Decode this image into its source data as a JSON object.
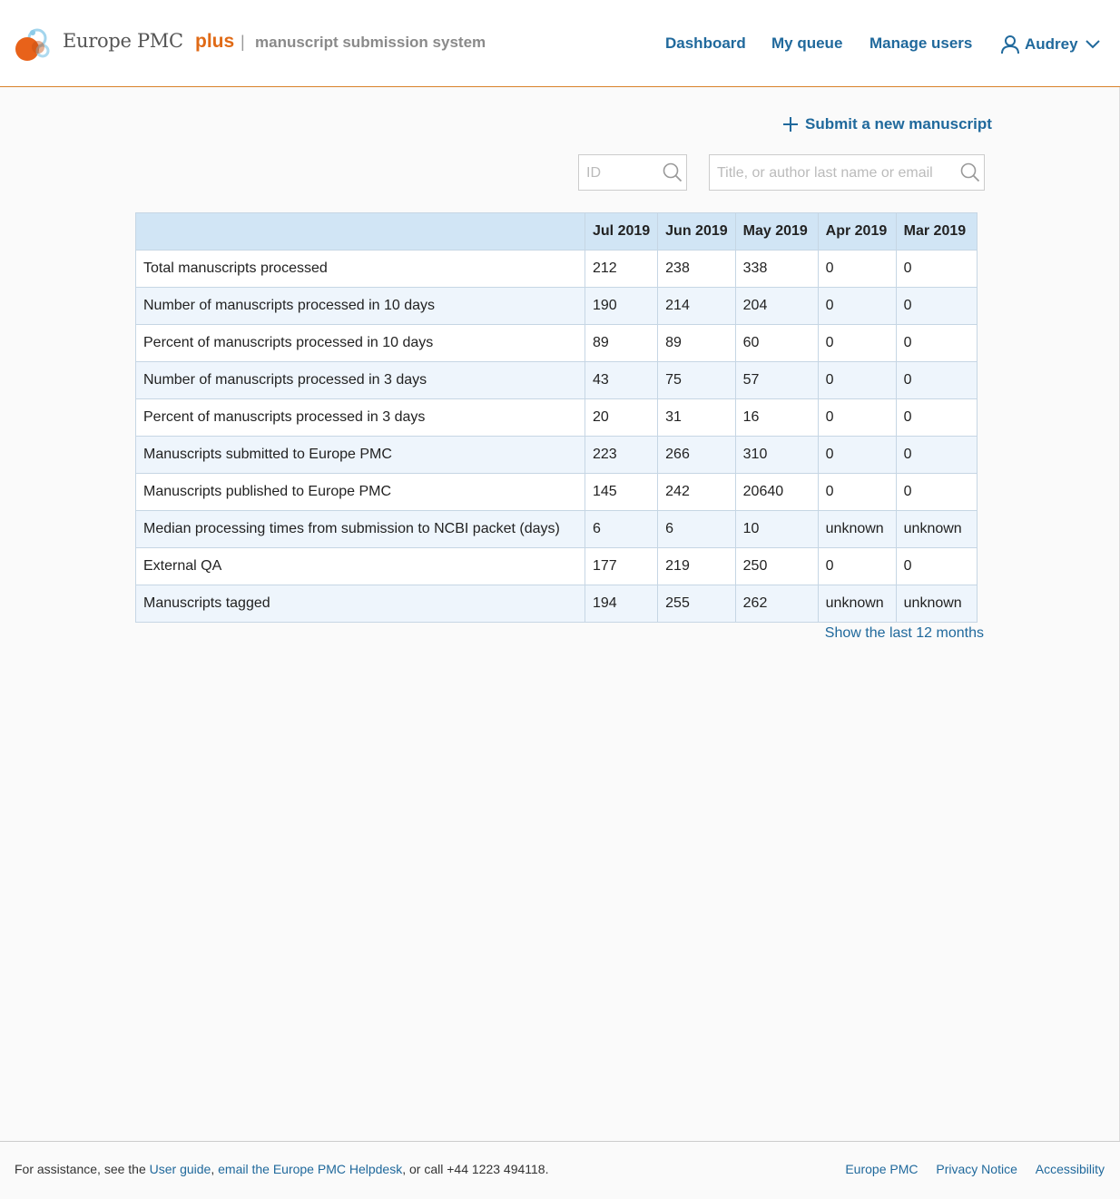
{
  "header": {
    "brand": "Europe PMC",
    "brand_plus": "plus",
    "separator": "|",
    "subtitle": "manuscript submission system",
    "nav": {
      "dashboard": "Dashboard",
      "my_queue": "My queue",
      "manage_users": "Manage users"
    },
    "user": {
      "name": "Audrey",
      "icon": "user-icon",
      "chevron_icon": "chevron-down-icon"
    }
  },
  "actions": {
    "submit_label": "Submit a new manuscript",
    "submit_icon": "plus-icon"
  },
  "search": {
    "id_placeholder": "ID",
    "id_value": "",
    "query_placeholder": "Title, or author last name or email",
    "query_value": "",
    "icon": "search-icon"
  },
  "stats": {
    "columns": [
      "",
      "Jul 2019",
      "Jun 2019",
      "May 2019",
      "Apr 2019",
      "Mar 2019"
    ],
    "rows": [
      [
        "Total manuscripts processed",
        "212",
        "238",
        "338",
        "0",
        "0"
      ],
      [
        "Number of manuscripts processed in 10 days",
        "190",
        "214",
        "204",
        "0",
        "0"
      ],
      [
        "Percent of manuscripts processed in 10 days",
        "89",
        "89",
        "60",
        "0",
        "0"
      ],
      [
        "Number of manuscripts processed in 3 days",
        "43",
        "75",
        "57",
        "0",
        "0"
      ],
      [
        "Percent of manuscripts processed in 3 days",
        "20",
        "31",
        "16",
        "0",
        "0"
      ],
      [
        "Manuscripts submitted to Europe PMC",
        "223",
        "266",
        "310",
        "0",
        "0"
      ],
      [
        "Manuscripts published to Europe PMC",
        "145",
        "242",
        "20640",
        "0",
        "0"
      ],
      [
        "Median processing times from submission to NCBI packet (days)",
        "6",
        "6",
        "10",
        "unknown",
        "unknown"
      ],
      [
        "External QA",
        "177",
        "219",
        "250",
        "0",
        "0"
      ],
      [
        "Manuscripts tagged",
        "194",
        "255",
        "262",
        "unknown",
        "unknown"
      ]
    ],
    "show_more": "Show the last 12 months"
  },
  "footer": {
    "prefix": "For assistance, see the ",
    "user_guide": "User guide",
    "comma": ", ",
    "helpdesk": "email the Europe PMC Helpdesk",
    "suffix": ", or call +44 1223 494118.",
    "links": {
      "europe_pmc": "Europe PMC",
      "privacy": "Privacy Notice",
      "accessibility": "Accessibility"
    }
  },
  "colors": {
    "link": "#20699c",
    "brand_orange": "#e06a16",
    "header_rule": "#d9822b",
    "table_header": "#d1e5f5",
    "table_stripe": "#eef5fc"
  }
}
